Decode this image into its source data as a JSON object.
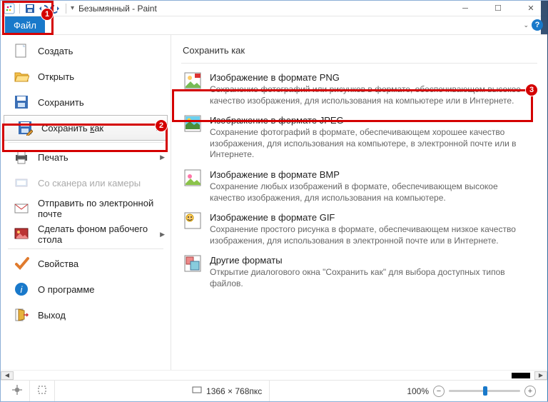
{
  "titlebar": {
    "document_name": "Безымянный",
    "app_name": "Paint"
  },
  "tabs": {
    "file": "Файл"
  },
  "file_menu": {
    "create": "Создать",
    "open": "Открыть",
    "save": "Сохранить",
    "save_as": "Сохранить как",
    "print": "Печать",
    "from_scanner": "Со сканера или камеры",
    "send_email": "Отправить по электронной почте",
    "set_wallpaper": "Сделать фоном рабочего стола",
    "properties": "Свойства",
    "about": "О программе",
    "exit": "Выход"
  },
  "save_as_panel": {
    "title": "Сохранить как",
    "formats": [
      {
        "id": "png",
        "title": "Изображение в формате PNG",
        "desc": "Сохранение фотографий или рисунков в формате, обеспечивающем высокое качество изображения, для использования на компьютере или в Интернете."
      },
      {
        "id": "jpeg",
        "title": "Изображение в формате JPEG",
        "desc": "Сохранение фотографий в формате, обеспечивающем хорошее качество изображения, для использования на компьютере, в электронной почте или в Интернете."
      },
      {
        "id": "bmp",
        "title": "Изображение в формате BMP",
        "desc": "Сохранение любых изображений в формате, обеспечивающем высокое качество изображения, для использования на компьютере."
      },
      {
        "id": "gif",
        "title": "Изображение в формате GIF",
        "desc": "Сохранение простого рисунка в формате, обеспечивающем низкое качество изображения, для использования в электронной почте или в Интернете."
      },
      {
        "id": "other",
        "title": "Другие форматы",
        "desc": "Открытие диалогового окна \"Сохранить как\" для выбора доступных типов файлов."
      }
    ]
  },
  "statusbar": {
    "canvas_size": "1366 × 768пкс",
    "zoom_percent": "100%"
  },
  "annotations": {
    "step1": "1",
    "step2": "2",
    "step3": "3"
  }
}
